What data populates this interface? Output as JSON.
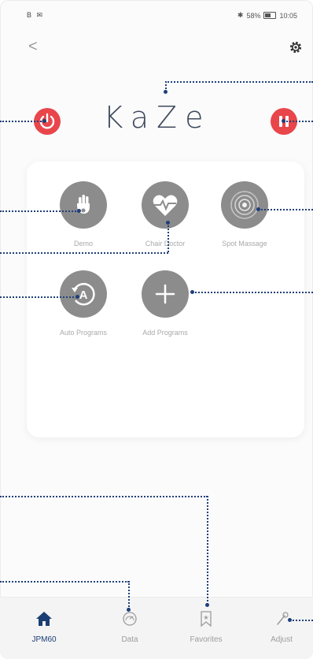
{
  "status_bar": {
    "left": "B ✉",
    "bluetooth": "✱",
    "battery": "58%",
    "time": "10:05"
  },
  "header": {
    "back_label": "<",
    "title": "KaZe"
  },
  "tiles": [
    {
      "label": "Demo",
      "icon": "hand-icon"
    },
    {
      "label": "Chair Doctor",
      "icon": "heart-pulse-icon"
    },
    {
      "label": "Spot Massage",
      "icon": "target-rings-icon"
    },
    {
      "label": "Auto Programs",
      "icon": "auto-a-icon"
    },
    {
      "label": "Add Programs",
      "icon": "plus-icon"
    }
  ],
  "tabs": [
    {
      "label": "JPM60",
      "icon": "home-icon",
      "active": true
    },
    {
      "label": "Data",
      "icon": "gauge-icon",
      "active": false
    },
    {
      "label": "Favorites",
      "icon": "bookmark-icon",
      "active": false
    },
    {
      "label": "Adjust",
      "icon": "wrench-icon",
      "active": false
    }
  ],
  "colors": {
    "accent_red": "#e8464b",
    "tile_gray": "#8c8c8c",
    "active_tab": "#1b3f74",
    "callout_line": "#1f3f7a"
  }
}
